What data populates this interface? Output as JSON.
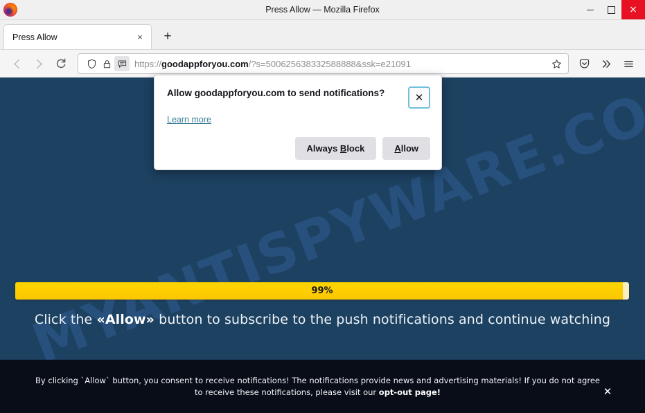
{
  "window": {
    "title": "Press Allow — Mozilla Firefox",
    "logo_icon": "firefox-logo",
    "minimize_label": "Minimize",
    "maximize_label": "Maximize",
    "close_label": "×"
  },
  "tabs": {
    "items": [
      {
        "label": "Press Allow",
        "close_label": "×"
      }
    ],
    "new_tab_label": "+"
  },
  "toolbar": {
    "back_label": "←",
    "forward_label": "→",
    "reload_label": "⟳",
    "pocket_icon": "pocket-save-icon",
    "overflow_label": "»",
    "menu_icon": "hamburger-menu-icon"
  },
  "urlbar": {
    "shield_icon": "tracking-protection-shield-icon",
    "lock_icon": "padlock-secure-icon",
    "permission_icon": "notification-permission-icon",
    "scheme": "https://",
    "host": "goodappforyou.com",
    "path_query": "/?s=500625638332588888&ssk=e21091",
    "full_url": "https://goodappforyou.com/?s=500625638332588888&ssk=e21091",
    "bookmark_icon": "star-bookmark-icon"
  },
  "permission_dialog": {
    "title": "Allow goodappforyou.com to send notifications?",
    "learn_more_label": "Learn more",
    "close_label": "✕",
    "always_block_label": "Always Block",
    "always_block_accel": "B",
    "allow_label": "Allow",
    "allow_accel": "A"
  },
  "page": {
    "background_color": "#1d4161",
    "watermark_text": "MYANTISPYWARE.COM",
    "progress": {
      "percent_label": "99%",
      "percent_value": 99,
      "fill_color": "#ffd000",
      "track_color": "#faeec0"
    },
    "cta": {
      "before": "Click the ",
      "emphasis": "«Allow»",
      "after": " button to subscribe to the push notifications and continue watching"
    }
  },
  "footer": {
    "text_part1": "By clicking `Allow` button, you consent to receive notifications! The notifications provide news and advertising materials! If you do not agree to receive these notifications, please visit our ",
    "link_label": "opt-out page!",
    "close_label": "✕",
    "background_color": "#080d17"
  }
}
